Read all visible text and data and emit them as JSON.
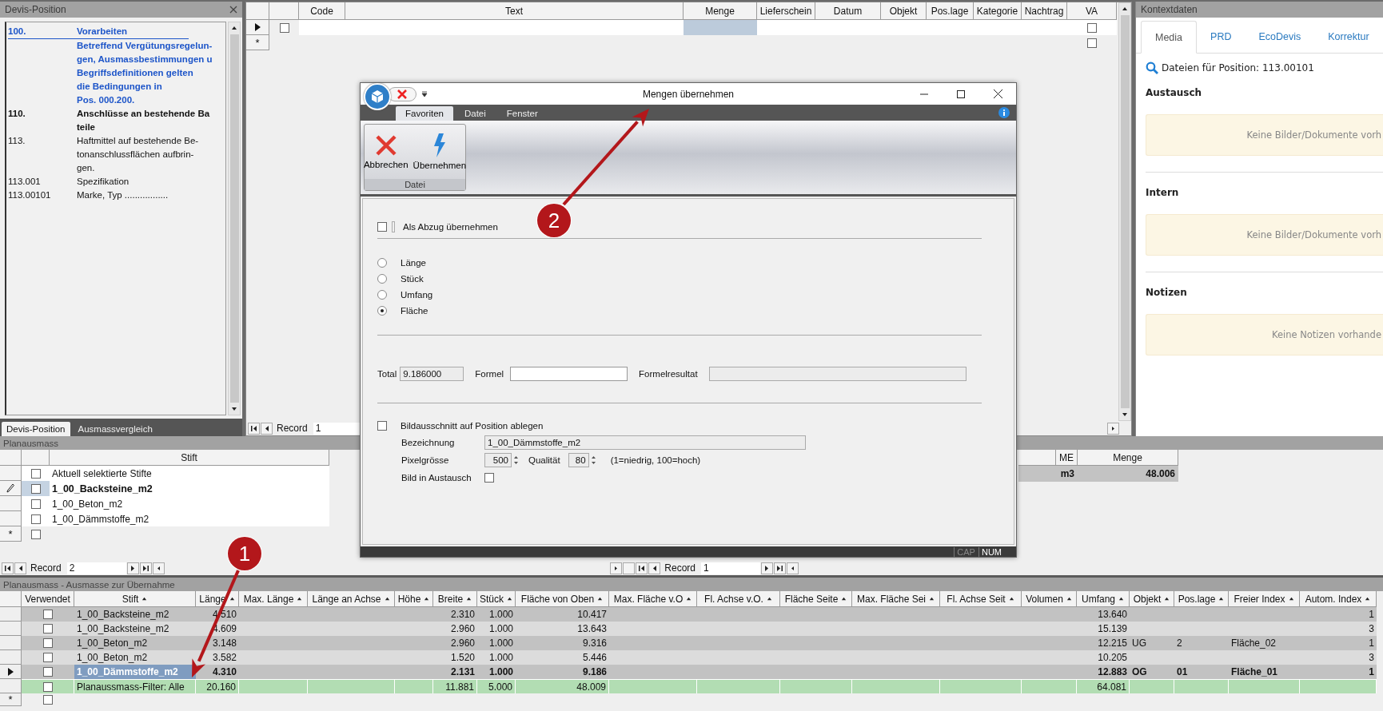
{
  "devis_panel": {
    "title": "Devis-Position",
    "items": [
      {
        "code": "100.",
        "lines": [
          "Vorarbeiten"
        ],
        "kind": "title"
      },
      {
        "lines": [
          "Betreffend Vergütungsregelun-",
          "gen, Ausmassbestimmungen u",
          "Begriffsdefinitionen gelten",
          "die Bedingungen in",
          "Pos. 000.200."
        ],
        "kind": "note"
      },
      {
        "code": "110.",
        "lines": [
          "Anschlüsse an bestehende Ba",
          "teile"
        ],
        "kind": "bold"
      },
      {
        "code": "113.",
        "lines": [
          "Haftmittel auf bestehende Be-",
          "tonanschlussflächen aufbrin-",
          "gen."
        ],
        "kind": "normal"
      },
      {
        "code": "113.001",
        "lines": [
          "Spezifikation"
        ],
        "kind": "normal"
      },
      {
        "code": "113.00101",
        "lines": [
          "Marke, Typ ................."
        ],
        "kind": "normal"
      }
    ],
    "tabs": [
      {
        "label": "Devis-Position",
        "selected": true
      },
      {
        "label": "Ausmassvergleich",
        "selected": false
      }
    ]
  },
  "position_grid": {
    "columns": [
      "Code",
      "Text",
      "Menge",
      "Lieferschein",
      "Datum",
      "Objekt",
      "Pos.lage",
      "Kategorie",
      "Nachtrag",
      "VA"
    ],
    "rows": [
      {
        "kind": "data",
        "current": true,
        "checked": false,
        "va_checked": false
      },
      {
        "kind": "new",
        "marker": "*",
        "va_checked": false
      }
    ],
    "record": {
      "label": "Record",
      "value": "1"
    }
  },
  "context_panel": {
    "title": "Kontextdaten",
    "tabs": [
      {
        "label": "Media",
        "selected": true
      },
      {
        "label": "PRD",
        "selected": false
      },
      {
        "label": "EcoDevis",
        "selected": false
      },
      {
        "label": "Korrektur",
        "selected": false
      }
    ],
    "search_label": "Dateien für Position: 113.00101",
    "sections": [
      {
        "heading": "Austausch",
        "message": "Keine Bilder/Dokumente vorh"
      },
      {
        "heading": "Intern",
        "message": "Keine Bilder/Dokumente vorh"
      },
      {
        "heading": "Notizen",
        "message": "Keine Notizen vorhande"
      }
    ]
  },
  "planausmass": {
    "title": "Planausmass",
    "column": "Stift",
    "rows": [
      {
        "kind": "data",
        "label": "Aktuell selektierte Stifte",
        "current": false,
        "checked": false
      },
      {
        "kind": "data",
        "label": "1_00_Backsteine_m2",
        "current": true,
        "checked": false
      },
      {
        "kind": "data",
        "label": "1_00_Beton_m2",
        "current": false,
        "checked": false
      },
      {
        "kind": "data",
        "label": "1_00_Dämmstoffe_m2",
        "current": false,
        "checked": false
      },
      {
        "kind": "new",
        "marker": "*",
        "checked": false
      }
    ],
    "summary": {
      "columns": [
        "ME",
        "Menge"
      ],
      "values": [
        "m3",
        "48.006"
      ]
    },
    "record_navs": [
      {
        "label": "Record",
        "value": "2"
      },
      {
        "label": "Record",
        "value": "1"
      }
    ]
  },
  "dialog": {
    "title": "Mengen übernehmen",
    "ribbon_tabs": [
      {
        "label": "Favoriten",
        "selected": true
      },
      {
        "label": "Datei",
        "selected": false
      },
      {
        "label": "Fenster",
        "selected": false
      }
    ],
    "ribbon_buttons": [
      {
        "label": "Abbrechen",
        "kind": "cancel"
      },
      {
        "label": "Übernehmen",
        "kind": "apply"
      }
    ],
    "ribbon_group": "Datei",
    "deduct": {
      "label": "Als Abzug übernehmen",
      "checked": false
    },
    "measures": [
      {
        "label": "Länge",
        "selected": false
      },
      {
        "label": "Stück",
        "selected": false
      },
      {
        "label": "Umfang",
        "selected": false
      },
      {
        "label": "Fläche",
        "selected": true
      }
    ],
    "total": {
      "label": "Total",
      "value": "9.186000"
    },
    "formula": {
      "label": "Formel"
    },
    "formula_result": {
      "label": "Formelresultat"
    },
    "image_crop": {
      "label": "Bildausschnitt auf Position ablegen",
      "checked": false
    },
    "designation": {
      "label": "Bezeichnung",
      "value": "1_00_Dämmstoffe_m2"
    },
    "pixel_size": {
      "label": "Pixelgrösse",
      "value": "500"
    },
    "quality": {
      "label": "Qualität",
      "value": "80"
    },
    "quality_hint": "(1=niedrig, 100=hoch)",
    "image_in_exchange": {
      "label": "Bild in Austausch",
      "checked": false
    },
    "status": [
      {
        "label": "CAP",
        "on": false
      },
      {
        "label": "NUM",
        "on": true
      }
    ]
  },
  "ausmasse": {
    "title": "Planausmass - Ausmasse zur Übernahme",
    "columns": [
      {
        "label": "Verwendet",
        "sorted": false
      },
      {
        "label": "Stift",
        "sorted": true
      },
      {
        "label": "Länge",
        "sorted": true
      },
      {
        "label": "Max. Länge",
        "sorted": true
      },
      {
        "label": "Länge an Achse",
        "sorted": true
      },
      {
        "label": "Höhe",
        "sorted": true
      },
      {
        "label": "Breite",
        "sorted": true
      },
      {
        "label": "Stück",
        "sorted": true
      },
      {
        "label": "Fläche von Oben",
        "sorted": true
      },
      {
        "label": "Max. Fläche v.O",
        "sorted": true
      },
      {
        "label": "Fl. Achse v.O.",
        "sorted": true
      },
      {
        "label": "Fläche Seite",
        "sorted": true
      },
      {
        "label": "Max. Fläche Sei",
        "sorted": true
      },
      {
        "label": "Fl. Achse Seit",
        "sorted": true
      },
      {
        "label": "Volumen",
        "sorted": true
      },
      {
        "label": "Umfang",
        "sorted": true
      },
      {
        "label": "Objekt",
        "sorted": true
      },
      {
        "label": "Pos.lage",
        "sorted": true
      },
      {
        "label": "Freier Index",
        "sorted": true
      },
      {
        "label": "Autom. Index",
        "sorted": true
      }
    ],
    "rows": [
      {
        "kind": "data",
        "current": false,
        "checked": false,
        "cells": [
          null,
          "1_00_Backsteine_m2",
          "4.510",
          null,
          null,
          null,
          "2.310",
          "1.000",
          "10.417",
          null,
          null,
          null,
          null,
          null,
          null,
          "13.640",
          null,
          null,
          null,
          "1"
        ]
      },
      {
        "kind": "data",
        "current": false,
        "checked": false,
        "cells": [
          null,
          "1_00_Backsteine_m2",
          "4.609",
          null,
          null,
          null,
          "2.960",
          "1.000",
          "13.643",
          null,
          null,
          null,
          null,
          null,
          null,
          "15.139",
          null,
          null,
          null,
          "3"
        ]
      },
      {
        "kind": "data",
        "current": false,
        "checked": false,
        "cells": [
          null,
          "1_00_Beton_m2",
          "3.148",
          null,
          null,
          null,
          "2.960",
          "1.000",
          "9.316",
          null,
          null,
          null,
          null,
          null,
          null,
          "12.215",
          "UG",
          "2",
          "Fläche_02",
          "1"
        ]
      },
      {
        "kind": "data",
        "current": false,
        "checked": false,
        "cells": [
          null,
          "1_00_Beton_m2",
          "3.582",
          null,
          null,
          null,
          "1.520",
          "1.000",
          "5.446",
          null,
          null,
          null,
          null,
          null,
          null,
          "10.205",
          null,
          null,
          null,
          "3"
        ]
      },
      {
        "kind": "data",
        "current": true,
        "checked": false,
        "cells": [
          null,
          "1_00_Dämmstoffe_m2",
          "4.310",
          null,
          null,
          null,
          "2.131",
          "1.000",
          "9.186",
          null,
          null,
          null,
          null,
          null,
          null,
          "12.883",
          "OG",
          "01",
          "Fläche_01",
          "1"
        ]
      },
      {
        "kind": "total",
        "checked": false,
        "cells": [
          null,
          "Planaussmass-Filter: Alle",
          "20.160",
          null,
          null,
          null,
          "11.881",
          "5.000",
          "48.009",
          null,
          null,
          null,
          null,
          null,
          null,
          "64.081",
          null,
          null,
          null,
          null
        ]
      },
      {
        "kind": "new",
        "marker": "*",
        "checked": false
      }
    ]
  },
  "callouts": [
    {
      "number": "2"
    },
    {
      "number": "1"
    }
  ]
}
